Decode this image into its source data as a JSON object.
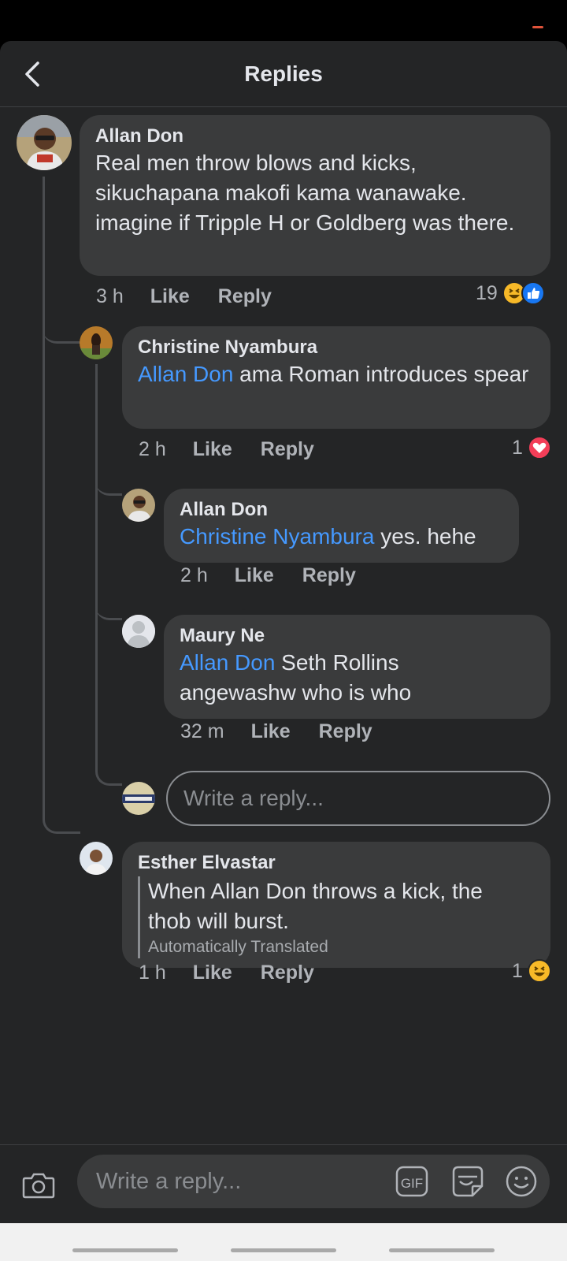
{
  "header": {
    "title": "Replies"
  },
  "comments": [
    {
      "author": "Allan Don",
      "text": "Real men throw blows and kicks, sikuchapana makofi kama wanawake. imagine if Tripple H or Goldberg was there.",
      "time": "3 h",
      "like_label": "Like",
      "reply_label": "Reply",
      "reaction_count": "19",
      "reactions": [
        "haha",
        "like"
      ]
    },
    {
      "author": "Christine Nyambura",
      "mention": "Allan Don",
      "text": " ama Roman introduces spear",
      "time": "2 h",
      "like_label": "Like",
      "reply_label": "Reply",
      "reaction_count": "1",
      "reactions": [
        "love"
      ]
    },
    {
      "author": "Allan Don",
      "mention": "Christine Nyambura",
      "text": " yes. hehe",
      "time": "2 h",
      "like_label": "Like",
      "reply_label": "Reply"
    },
    {
      "author": "Maury Ne",
      "mention": "Allan Don",
      "text": " Seth Rollins angewashw who is who",
      "time": "32 m",
      "like_label": "Like",
      "reply_label": "Reply"
    },
    {
      "author": "Esther Elvastar",
      "text": "When Allan Don throws a kick, the thob will burst.",
      "translated_note": "Automatically Translated",
      "time": "1 h",
      "like_label": "Like",
      "reply_label": "Reply",
      "reaction_count": "1",
      "reactions": [
        "haha"
      ]
    }
  ],
  "inline_reply": {
    "placeholder": "Write a reply..."
  },
  "composer": {
    "placeholder": "Write a reply...",
    "gif_label": "GIF"
  },
  "colors": {
    "background": "#242526",
    "bubble": "#3a3b3c",
    "mention": "#4599ff",
    "like": "#1877f2",
    "love": "#f33e58",
    "haha": "#f7b928"
  }
}
